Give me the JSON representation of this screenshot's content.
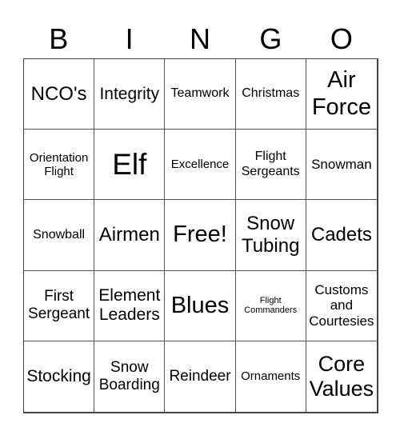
{
  "header": {
    "letters": [
      "B",
      "I",
      "N",
      "G",
      "O"
    ]
  },
  "cells": [
    "NCO's",
    "Integrity",
    "Teamwork",
    "Christmas",
    "Air Force",
    "Orientation Flight",
    "Elf",
    "Excellence",
    "Flight Sergeants",
    "Snowman",
    "Snowball",
    "Airmen",
    "Free!",
    "Snow Tubing",
    "Cadets",
    "First Sergeant",
    "Element Leaders",
    "Blues",
    "Flight Commanders",
    "Customs and Courtesies",
    "Stocking",
    "Snow Boarding",
    "Reindeer",
    "Ornaments",
    "Core Values"
  ]
}
